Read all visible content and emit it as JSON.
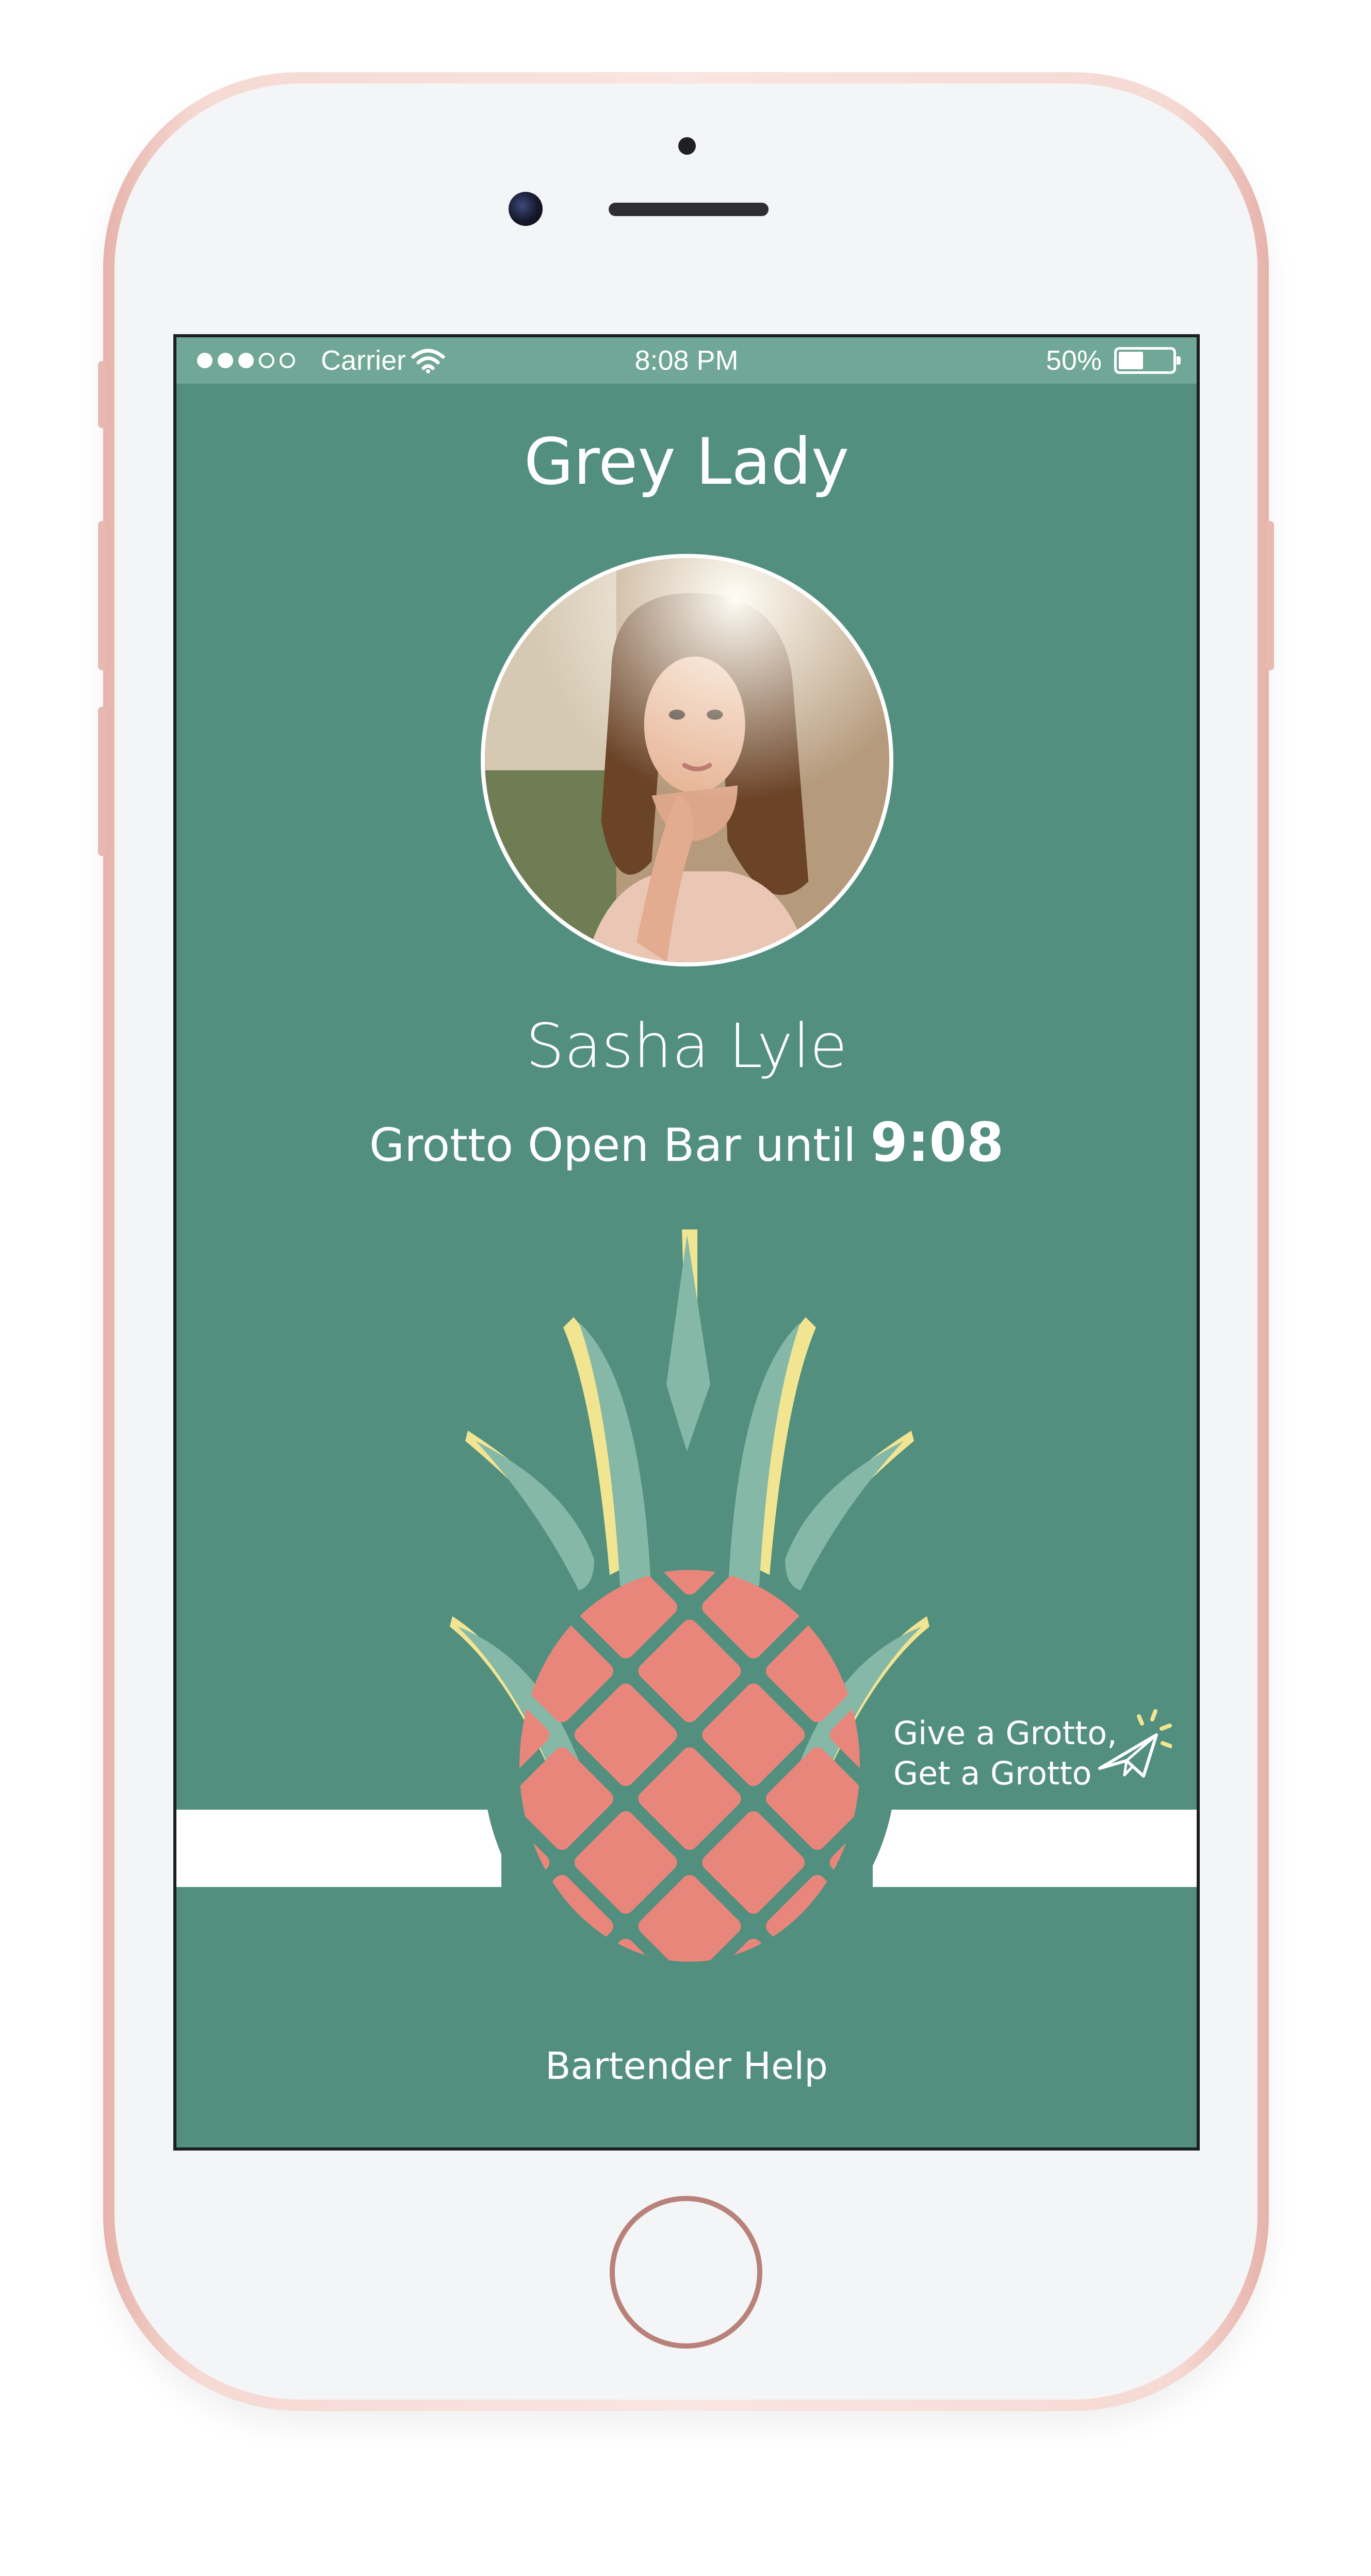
{
  "status_bar": {
    "carrier": "Carrier",
    "time": "8:08 PM",
    "battery_percent": "50%",
    "battery_level": 0.5,
    "signal_bars_filled": 3,
    "signal_bars_total": 5
  },
  "venue": {
    "title": "Grey Lady"
  },
  "user": {
    "name": "Sasha Lyle"
  },
  "open_bar": {
    "prefix": "Grotto Open Bar until ",
    "time": "9:08"
  },
  "promo": {
    "line1": "Give a Grotto,",
    "line2": "Get a Grotto"
  },
  "footer": {
    "help_label": "Bartender Help"
  },
  "colors": {
    "screen_bg": "#528f7e",
    "status_bg": "#71a797",
    "pineapple_body": "#e9867b",
    "leaf": "#86b8a7",
    "leaf_accent": "#f2e592",
    "phone_rose": "#e6b3ab"
  },
  "icons": {
    "wifi": "wifi-icon",
    "battery": "battery-icon",
    "paper_plane": "paper-plane-icon",
    "pineapple": "pineapple-illustration"
  }
}
